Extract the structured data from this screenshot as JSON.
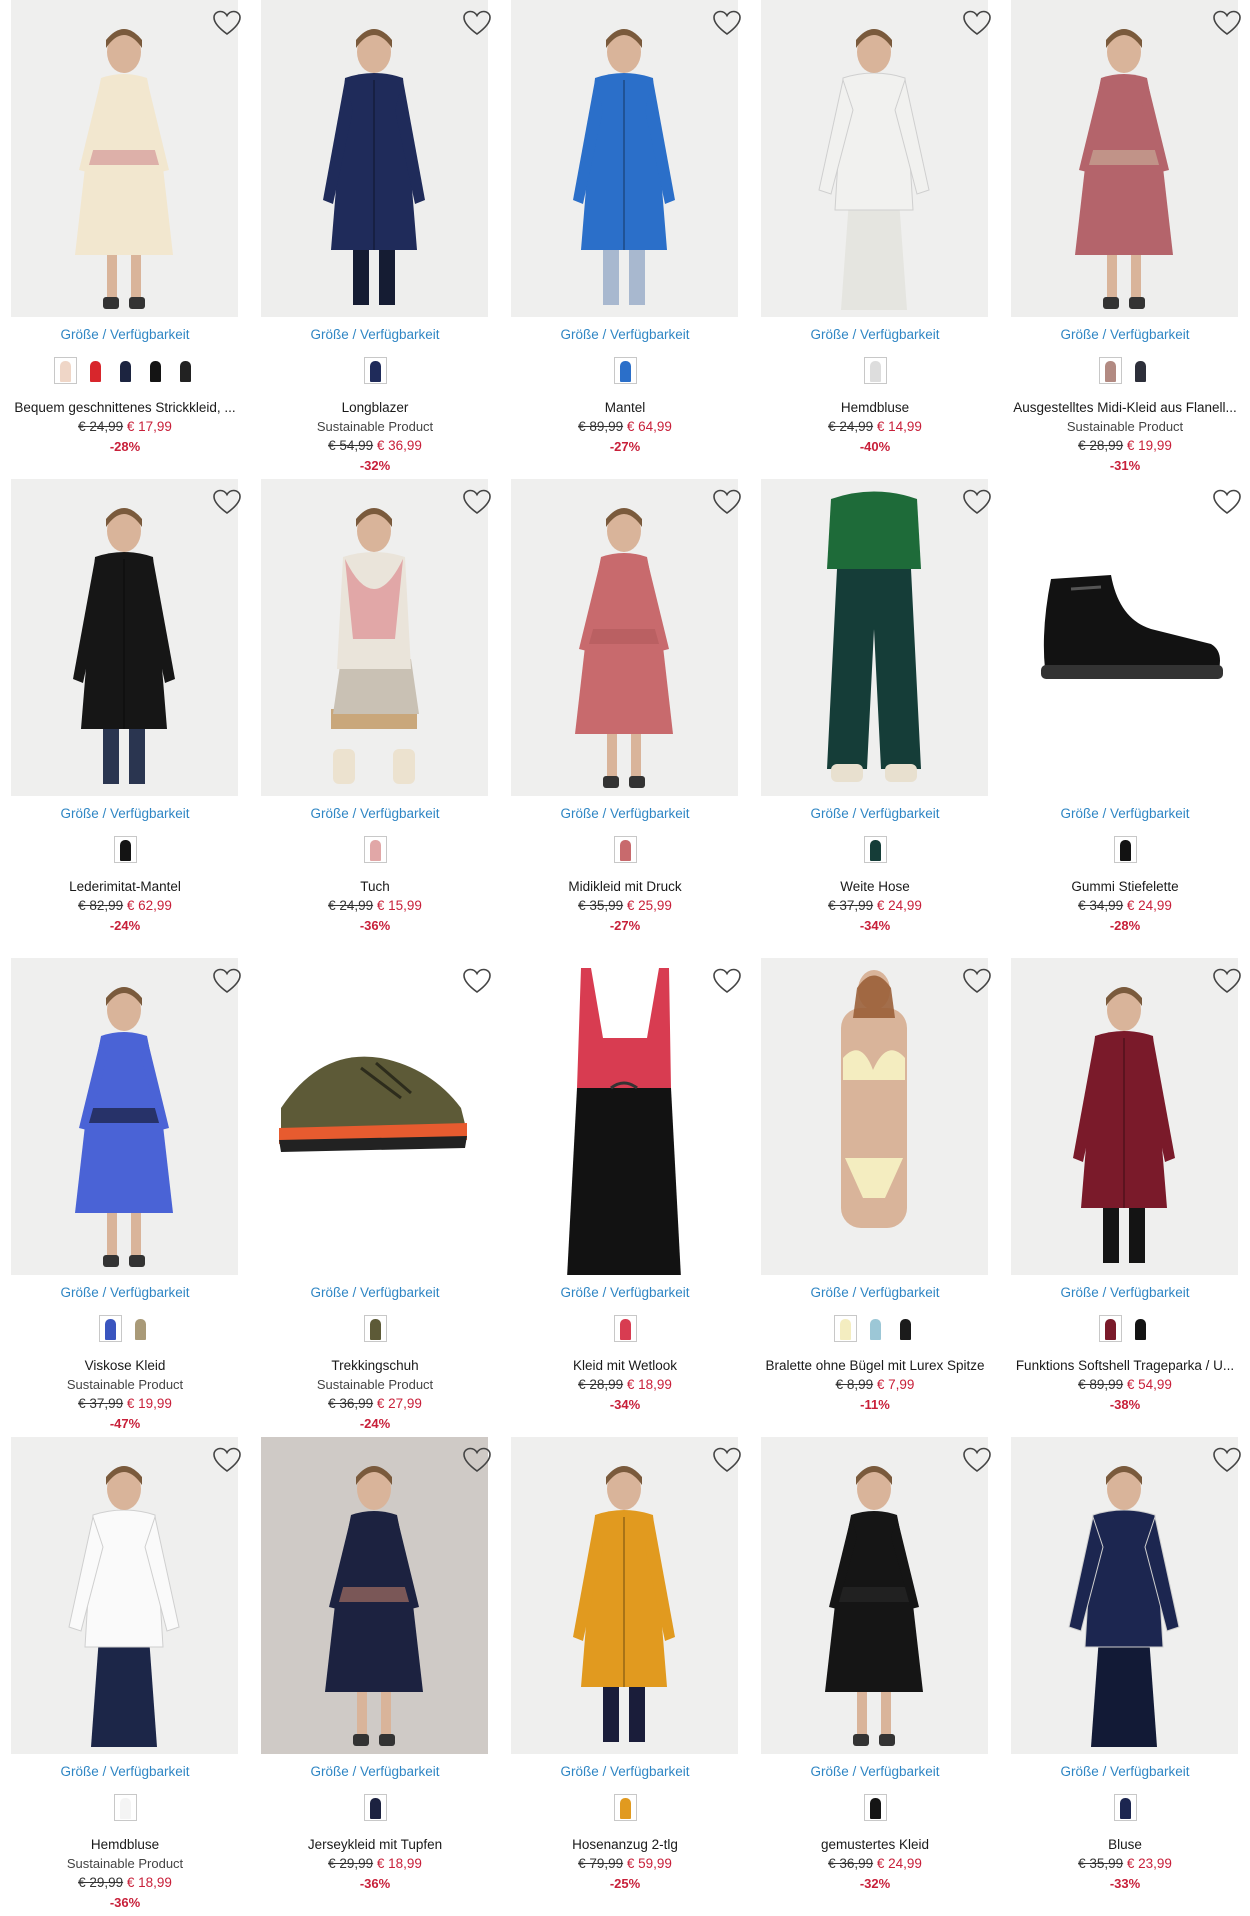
{
  "labels": {
    "size_link": "Größe / Verfügbarkeit"
  },
  "colors": {
    "link": "#2f86c4",
    "sale": "#c8203a"
  },
  "products": [
    {
      "name": "Bequem geschnittenes Strickkleid, ...",
      "tag": "",
      "old": "€ 24,99",
      "new": "€ 17,99",
      "disc": "-28%",
      "illus": "dress",
      "bg": "#efefee",
      "c1": "#f2e7cf",
      "c2": "#cf8c8f",
      "swatches": [
        "#efd6c7",
        "#d8262c",
        "#1c2440",
        "#141414",
        "#222222"
      ]
    },
    {
      "name": "Longblazer",
      "tag": "Sustainable Product",
      "old": "€ 54,99",
      "new": "€ 36,99",
      "disc": "-32%",
      "illus": "coat",
      "bg": "#eeeeed",
      "c1": "#1f2b5a",
      "c2": "#151c33",
      "swatches": [
        "#1f2b5a"
      ]
    },
    {
      "name": "Mantel",
      "tag": "",
      "old": "€ 89,99",
      "new": "€ 64,99",
      "disc": "-27%",
      "illus": "coat",
      "bg": "#efefee",
      "c1": "#2b6fc9",
      "c2": "#a8b8cf",
      "swatches": [
        "#2b6fc9"
      ]
    },
    {
      "name": "Hemdbluse",
      "tag": "",
      "old": "€ 24,99",
      "new": "€ 14,99",
      "disc": "-40%",
      "illus": "top",
      "bg": "#efefee",
      "c1": "#f1f1ef",
      "c2": "#e5e5e0",
      "swatches": [
        "#dddddd"
      ]
    },
    {
      "name": "Ausgestelltes Midi-Kleid aus Flanell...",
      "tag": "Sustainable Product",
      "old": "€ 28,99",
      "new": "€ 19,99",
      "disc": "-31%",
      "illus": "dress",
      "bg": "#eeeeed",
      "c1": "#b4646b",
      "c2": "#c9b29b",
      "swatches": [
        "#b28a82",
        "#2d2f3a"
      ]
    },
    {
      "name": "Lederimitat-Mantel",
      "tag": "",
      "old": "€ 82,99",
      "new": "€ 62,99",
      "disc": "-24%",
      "illus": "coat",
      "bg": "#efefee",
      "c1": "#161616",
      "c2": "#2a3550",
      "swatches": [
        "#141414"
      ]
    },
    {
      "name": "Tuch",
      "tag": "",
      "old": "€ 24,99",
      "new": "€ 15,99",
      "disc": "-36%",
      "illus": "scarf",
      "bg": "#efefee",
      "c1": "#e1a7a7",
      "c2": "#c9c1b4",
      "swatches": [
        "#e1a7a7"
      ]
    },
    {
      "name": "Midikleid mit Druck",
      "tag": "",
      "old": "€ 35,99",
      "new": "€ 25,99",
      "disc": "-27%",
      "illus": "dress",
      "bg": "#efefee",
      "c1": "#c86a6d",
      "c2": "#b05a5c",
      "swatches": [
        "#c86a6d"
      ]
    },
    {
      "name": "Weite Hose",
      "tag": "",
      "old": "€ 37,99",
      "new": "€ 24,99",
      "disc": "-34%",
      "illus": "pants",
      "bg": "#efefee",
      "c1": "#153d38",
      "c2": "#1e6b39",
      "swatches": [
        "#153d38"
      ]
    },
    {
      "name": "Gummi Stiefelette",
      "tag": "",
      "old": "€ 34,99",
      "new": "€ 24,99",
      "disc": "-28%",
      "illus": "boot",
      "bg": "#ffffff",
      "c1": "#121212",
      "c2": "#333333",
      "swatches": [
        "#121212"
      ]
    },
    {
      "name": "Viskose Kleid",
      "tag": "Sustainable Product",
      "old": "€ 37,99",
      "new": "€ 19,99",
      "disc": "-47%",
      "illus": "dress",
      "bg": "#efefee",
      "c1": "#4a63d6",
      "c2": "#10131f",
      "swatches": [
        "#3a55bf",
        "#a99a78"
      ]
    },
    {
      "name": "Trekkingschuh",
      "tag": "Sustainable Product",
      "old": "€ 36,99",
      "new": "€ 27,99",
      "disc": "-24%",
      "illus": "shoe",
      "bg": "#ffffff",
      "c1": "#5d5a37",
      "c2": "#e75b2f",
      "swatches": [
        "#5d5a37"
      ]
    },
    {
      "name": "Kleid mit Wetlook",
      "tag": "",
      "old": "€ 28,99",
      "new": "€ 18,99",
      "disc": "-34%",
      "illus": "slip",
      "bg": "#ffffff",
      "c1": "#121212",
      "c2": "#d83c51",
      "swatches": [
        "#d83c51"
      ]
    },
    {
      "name": "Bralette ohne Bügel mit Lurex Spitze",
      "tag": "",
      "old": "€ 8,99",
      "new": "€ 7,99",
      "disc": "-11%",
      "illus": "lingerie",
      "bg": "#efefee",
      "c1": "#f4edc0",
      "c2": "#e8c1a8",
      "swatches": [
        "#f4edc0",
        "#9cc7d6",
        "#1b1b1b"
      ]
    },
    {
      "name": "Funktions Softshell Trageparka / U...",
      "tag": "",
      "old": "€ 89,99",
      "new": "€ 54,99",
      "disc": "-38%",
      "illus": "coat",
      "bg": "#efefee",
      "c1": "#7a1a2a",
      "c2": "#141414",
      "swatches": [
        "#7a1a2a",
        "#141414"
      ]
    },
    {
      "name": "Hemdbluse",
      "tag": "Sustainable Product",
      "old": "€ 29,99",
      "new": "€ 18,99",
      "disc": "-36%",
      "illus": "top",
      "bg": "#efefee",
      "c1": "#fafafa",
      "c2": "#1c2648",
      "swatches": [
        "#f4f4f4"
      ]
    },
    {
      "name": "Jerseykleid mit Tupfen",
      "tag": "",
      "old": "€ 29,99",
      "new": "€ 18,99",
      "disc": "-36%",
      "illus": "dress",
      "bg": "#cfcac6",
      "c1": "#1c2240",
      "c2": "#b97b68",
      "swatches": [
        "#1c2240"
      ]
    },
    {
      "name": "Hosenanzug 2-tlg",
      "tag": "",
      "old": "€ 79,99",
      "new": "€ 59,99",
      "disc": "-25%",
      "illus": "coat",
      "bg": "#efefee",
      "c1": "#e19a1f",
      "c2": "#1a1d3a",
      "swatches": [
        "#e19a1f"
      ]
    },
    {
      "name": "gemustertes Kleid",
      "tag": "",
      "old": "€ 36,99",
      "new": "€ 24,99",
      "disc": "-32%",
      "illus": "dress",
      "bg": "#efefee",
      "c1": "#151515",
      "c2": "#2a2a2a",
      "swatches": [
        "#151515"
      ]
    },
    {
      "name": "Bluse",
      "tag": "",
      "old": "€ 35,99",
      "new": "€ 23,99",
      "disc": "-33%",
      "illus": "top",
      "bg": "#efefee",
      "c1": "#1c2650",
      "c2": "#121a36",
      "swatches": [
        "#1c2650"
      ]
    }
  ]
}
